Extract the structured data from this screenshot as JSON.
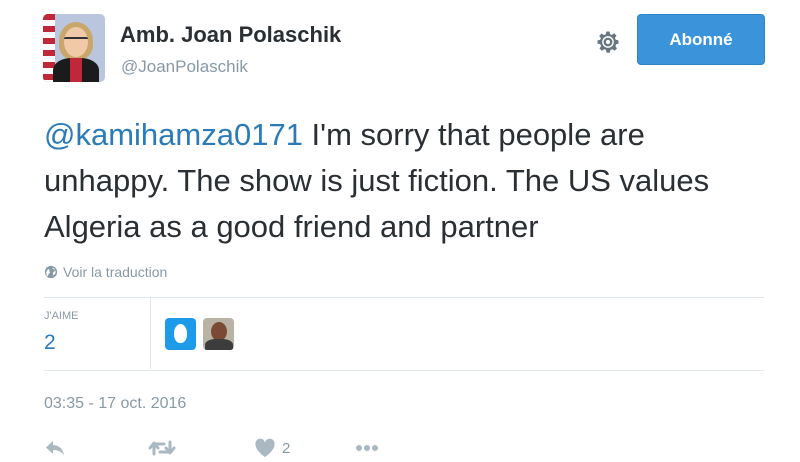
{
  "author": {
    "name": "Amb. Joan Polaschik",
    "handle": "@JoanPolaschik",
    "avatar_icon": "profile-photo"
  },
  "header": {
    "settings_icon": "gear-icon",
    "follow_label": "Abonné"
  },
  "tweet": {
    "mention": "@kamihamza0171",
    "text": " I'm sorry that people are unhappy.  The show is just fiction.  The US values Algeria as a good friend and partner"
  },
  "translate": {
    "icon": "globe-icon",
    "label": "Voir la traduction"
  },
  "stats": {
    "likes_label": "J'AIME",
    "likes_count": "2",
    "likers": [
      "default-egg-avatar",
      "user-photo-avatar"
    ]
  },
  "timestamp": "03:35 - 17 oct. 2016",
  "actions": {
    "reply_icon": "reply-icon",
    "retweet_icon": "retweet-icon",
    "like_icon": "heart-icon",
    "like_count": "2",
    "more_icon": "more-icon"
  },
  "colors": {
    "accent": "#2b7bb9",
    "button": "#3b94d9",
    "muted": "#8899a6",
    "icon": "#aab8c2"
  }
}
